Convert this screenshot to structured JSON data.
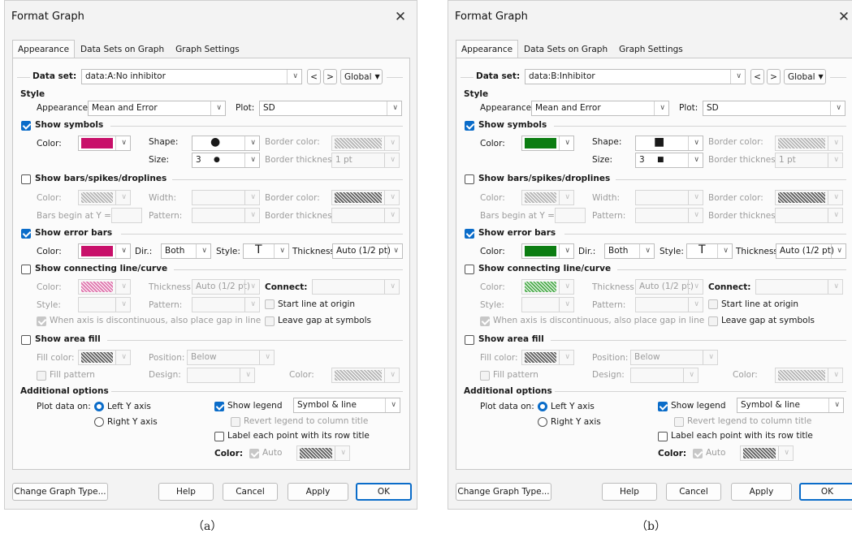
{
  "panels": [
    {
      "title": "Format Graph",
      "close": "✕",
      "tabs": [
        "Appearance",
        "Data Sets on Graph",
        "Graph Settings"
      ],
      "data_set_label": "Data set:",
      "data_set_value": "data:A:No inhibitor",
      "prev_label": "<",
      "next_label": ">",
      "global_label": "Global",
      "style_header": "Style",
      "appearance_label": "Appearance:",
      "appearance_value": "Mean and Error",
      "plot_label": "Plot:",
      "plot_value": "SD",
      "show_symbols": "Show symbols",
      "color_label": "Color:",
      "symbol_color": "#c8106a",
      "shape_label": "Shape:",
      "shape_glyph": "●",
      "border_color_label": "Border color:",
      "size_label": "Size:",
      "size_value": "3",
      "size_glyph": "●",
      "border_thickness_label": "Border thickness:",
      "border_thickness_value": "1 pt",
      "show_bars": "Show bars/spikes/droplines",
      "width_label": "Width:",
      "bars_begin_label": "Bars begin at Y =",
      "pattern_label": "Pattern:",
      "show_error_bars": "Show error bars",
      "error_color": "#c8106a",
      "dir_label": "Dir.:",
      "dir_value": "Both",
      "style_label": "Style:",
      "style_glyph": "T",
      "thickness_label": "Thickness",
      "thickness_value": "Auto (1/2 pt)",
      "show_connecting": "Show connecting line/curve",
      "thickness_label2": "Thickness:",
      "conn_thickness_value": "Auto (1/2 pt)",
      "connect_label": "Connect:",
      "style_label2": "Style:",
      "start_line_origin": "Start line at origin",
      "discontinuous_text": "When axis is discontinuous, also place gap in line",
      "leave_gap": "Leave gap at symbols",
      "show_area_fill": "Show area fill",
      "fill_color_label": "Fill color:",
      "position_label": "Position:",
      "position_value": "Below",
      "fill_pattern": "Fill pattern",
      "design_label": "Design:",
      "color_label2": "Color:",
      "additional_header": "Additional options",
      "plot_data_on": "Plot data on:",
      "left_axis": "Left Y axis",
      "right_axis": "Right  Y axis",
      "show_legend": "Show legend",
      "legend_value": "Symbol & line",
      "revert_legend": "Revert legend to column title",
      "label_each_point": "Label each point with its row title",
      "auto_label": "Auto",
      "change_type": "Change Graph Type...",
      "help": "Help",
      "cancel": "Cancel",
      "apply": "Apply",
      "ok": "OK",
      "caption": "（a）",
      "line_color": "pink",
      "shape_type": "circle"
    },
    {
      "title": "Format Graph",
      "close": "✕",
      "tabs": [
        "Appearance",
        "Data Sets on Graph",
        "Graph Settings"
      ],
      "data_set_label": "Data set:",
      "data_set_value": "data:B:Inhibitor",
      "prev_label": "<",
      "next_label": ">",
      "global_label": "Global",
      "style_header": "Style",
      "appearance_label": "Appearance:",
      "appearance_value": "Mean and Error",
      "plot_label": "Plot:",
      "plot_value": "SD",
      "show_symbols": "Show symbols",
      "color_label": "Color:",
      "symbol_color": "#0c7d12",
      "shape_label": "Shape:",
      "shape_glyph": "■",
      "border_color_label": "Border color:",
      "size_label": "Size:",
      "size_value": "3",
      "size_glyph": "■",
      "border_thickness_label": "Border thickness:",
      "border_thickness_value": "1 pt",
      "show_bars": "Show bars/spikes/droplines",
      "width_label": "Width:",
      "bars_begin_label": "Bars begin at Y =",
      "pattern_label": "Pattern:",
      "show_error_bars": "Show error bars",
      "error_color": "#0c7d12",
      "dir_label": "Dir.:",
      "dir_value": "Both",
      "style_label": "Style:",
      "style_glyph": "T",
      "thickness_label": "Thickness",
      "thickness_value": "Auto (1/2 pt)",
      "show_connecting": "Show connecting line/curve",
      "thickness_label2": "Thickness:",
      "conn_thickness_value": "Auto (1/2 pt)",
      "connect_label": "Connect:",
      "style_label2": "Style:",
      "start_line_origin": "Start line at origin",
      "discontinuous_text": "When axis is discontinuous, also place gap in line",
      "leave_gap": "Leave gap at symbols",
      "show_area_fill": "Show area fill",
      "fill_color_label": "Fill color:",
      "position_label": "Position:",
      "position_value": "Below",
      "fill_pattern": "Fill pattern",
      "design_label": "Design:",
      "color_label2": "Color:",
      "additional_header": "Additional options",
      "plot_data_on": "Plot data on:",
      "left_axis": "Left Y axis",
      "right_axis": "Right  Y axis",
      "show_legend": "Show legend",
      "legend_value": "Symbol & line",
      "revert_legend": "Revert legend to column title",
      "label_each_point": "Label each point with its row title",
      "auto_label": "Auto",
      "change_type": "Change Graph Type...",
      "help": "Help",
      "cancel": "Cancel",
      "apply": "Apply",
      "ok": "OK",
      "caption": "（b）",
      "line_color": "green",
      "shape_type": "square"
    }
  ]
}
